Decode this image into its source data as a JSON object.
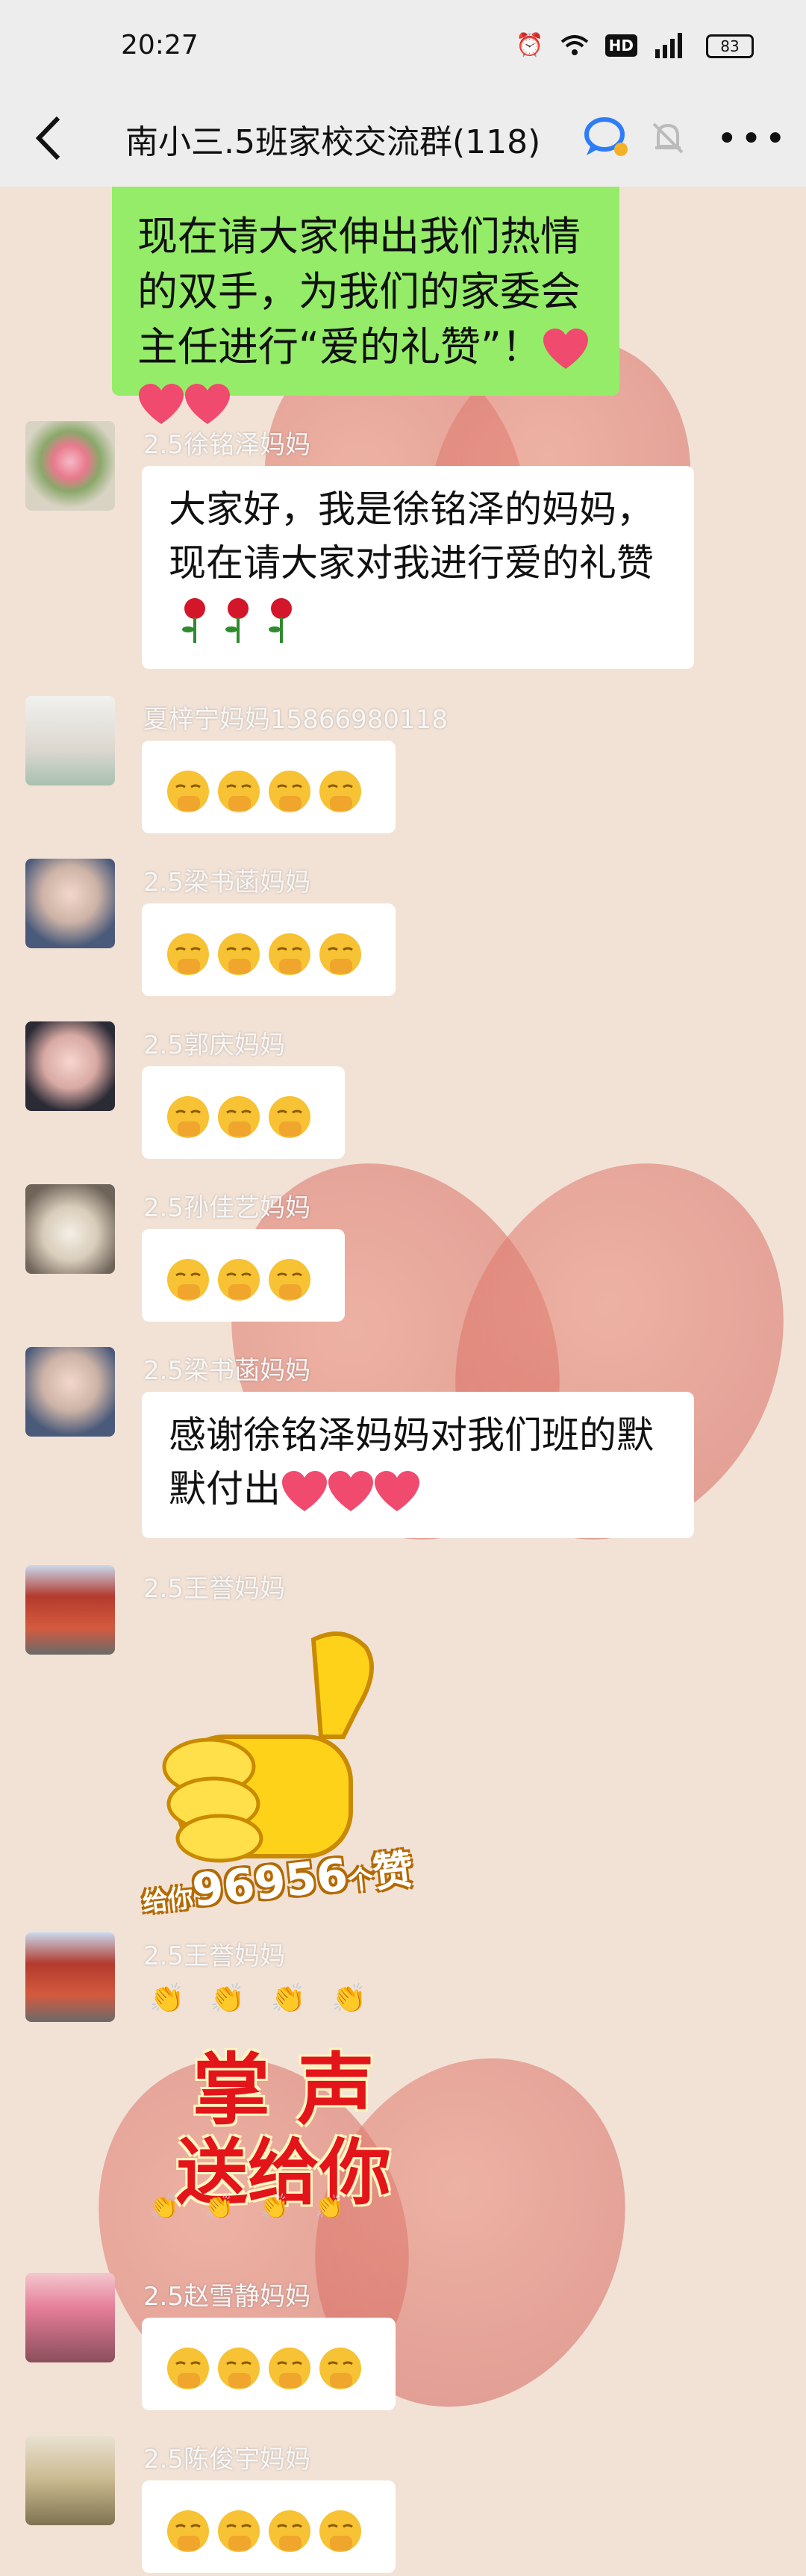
{
  "status_bar": {
    "time": "20:27",
    "battery": "83",
    "net_label": "HD"
  },
  "header": {
    "title": "南小三.5班家校交流群(118)"
  },
  "messages": {
    "m0": {
      "text": "现在请大家伸出我们热情的双手，为我们的家委会主任进行“爱的礼赞”！"
    },
    "m1": {
      "name": "2.5徐铭泽妈妈",
      "text": "大家好，我是徐铭泽的妈妈，现在请大家对我进行爱的礼赞"
    },
    "m2": {
      "name": "夏梓宁妈妈15866980118"
    },
    "m3": {
      "name": "2.5梁书菡妈妈"
    },
    "m4": {
      "name": "2.5郭庆妈妈"
    },
    "m5": {
      "name": "2.5孙佳艺妈妈"
    },
    "m6": {
      "name": "2.5梁书菡妈妈",
      "text": "感谢徐铭泽妈妈对我们班的默默付出"
    },
    "m7": {
      "name": "2.5王誉妈妈",
      "sticker": {
        "pre": "给你",
        "number": "96956",
        "mid": "个",
        "word": "赞"
      }
    },
    "m8": {
      "name": "2.5王誉妈妈",
      "sticker": {
        "line1": "掌 声",
        "line2": "送给你"
      }
    },
    "m9": {
      "name": "2.5赵雪静妈妈"
    },
    "m10": {
      "name": "2.5陈俊宇妈妈"
    }
  },
  "colors": {
    "self_bubble": "#95ec69",
    "other_bubble": "#ffffff",
    "header_bg": "#ededed"
  },
  "icons": [
    "back-icon",
    "group-badge-icon",
    "mute-bell-icon",
    "more-icon",
    "alarm-icon",
    "wifi-icon",
    "signal-icon",
    "battery-icon",
    "hush-emoji-icon",
    "red-heart-icon",
    "rose-icon"
  ]
}
